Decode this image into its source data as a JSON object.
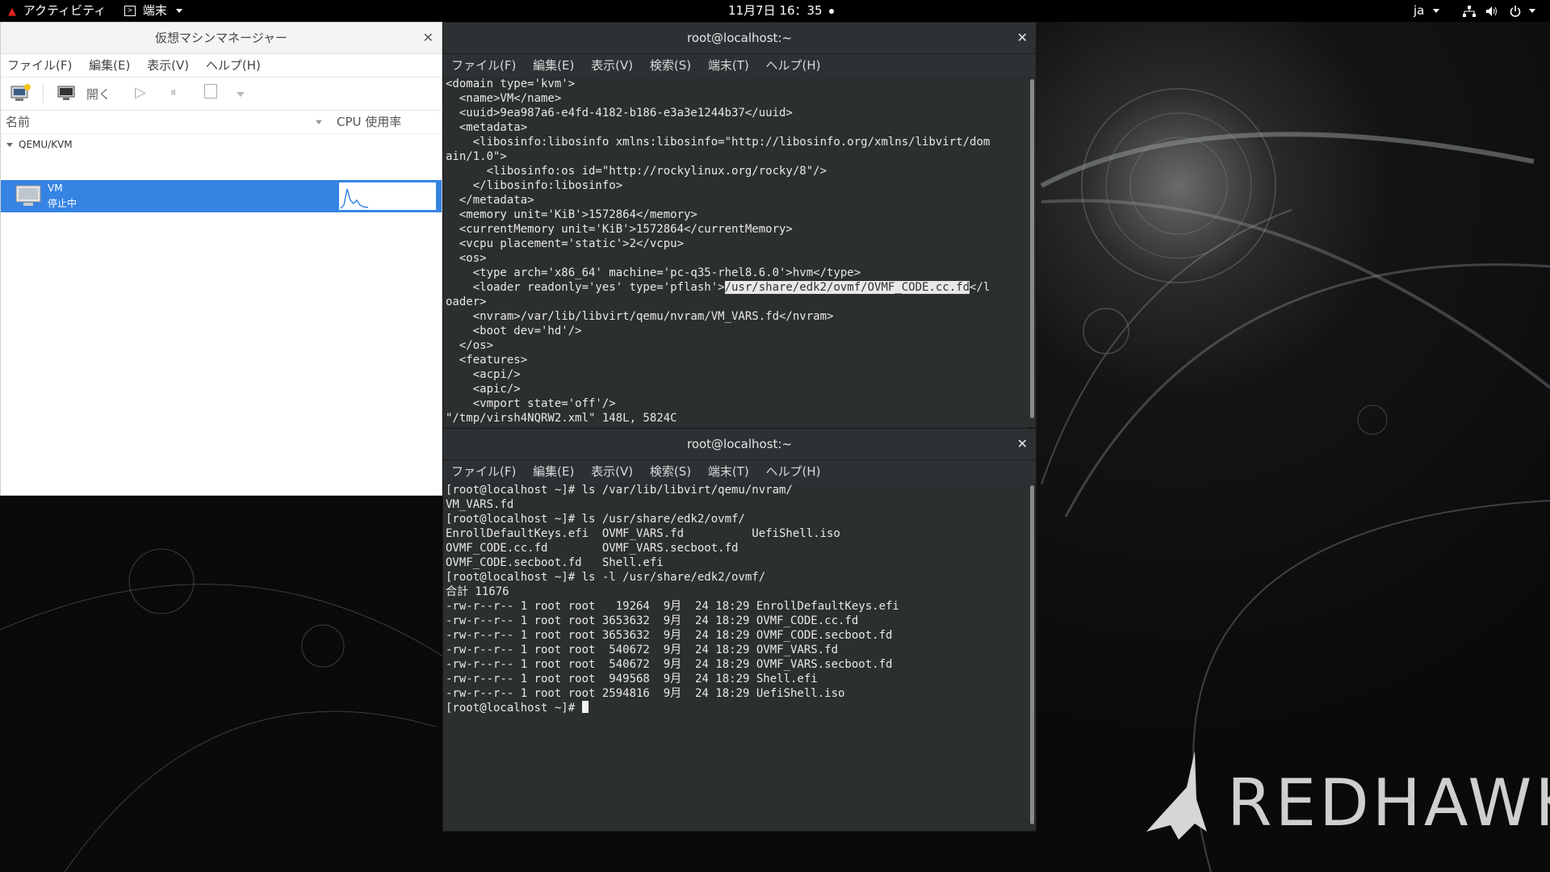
{
  "topbar": {
    "activities": "アクティビティ",
    "app_menu": "端末",
    "clock": "11月7日 16：35",
    "lang": "ja"
  },
  "vmm": {
    "title": "仮想マシンマネージャー",
    "menu": [
      "ファイル(F)",
      "編集(E)",
      "表示(V)",
      "ヘルプ(H)"
    ],
    "toolbar_open": "開く",
    "col_name": "名前",
    "col_cpu": "CPU 使用率",
    "group": "QEMU/KVM",
    "vm_name": "VM",
    "vm_status": "停止中"
  },
  "term_menu": [
    "ファイル(F)",
    "編集(E)",
    "表示(V)",
    "検索(S)",
    "端末(T)",
    "ヘルプ(H)"
  ],
  "term1": {
    "title": "root@localhost:~",
    "lines": [
      "<domain type='kvm'>",
      "  <name>VM</name>",
      "  <uuid>9ea987a6-e4fd-4182-b186-e3a3e1244b37</uuid>",
      "  <metadata>",
      "    <libosinfo:libosinfo xmlns:libosinfo=\"http://libosinfo.org/xmlns/libvirt/dom",
      "ain/1.0\">",
      "      <libosinfo:os id=\"http://rockylinux.org/rocky/8\"/>",
      "    </libosinfo:libosinfo>",
      "  </metadata>",
      "  <memory unit='KiB'>1572864</memory>",
      "  <currentMemory unit='KiB'>1572864</currentMemory>",
      "  <vcpu placement='static'>2</vcpu>",
      "  <os>",
      "    <type arch='x86_64' machine='pc-q35-rhel8.6.0'>hvm</type>"
    ],
    "loader_prefix": "    <loader readonly='yes' type='pflash'>",
    "loader_highlight": "/usr/share/edk2/ovmf/OVMF_CODE.cc.fd",
    "loader_suffix": "</l",
    "lines2": [
      "oader>",
      "    <nvram>/var/lib/libvirt/qemu/nvram/VM_VARS.fd</nvram>",
      "    <boot dev='hd'/>",
      "  </os>",
      "  <features>",
      "    <acpi/>",
      "    <apic/>",
      "    <vmport state='off'/>",
      "\"/tmp/virsh4NQRW2.xml\" 148L, 5824C"
    ]
  },
  "term2": {
    "title": "root@localhost:~",
    "lines": [
      "[root@localhost ~]# ls /var/lib/libvirt/qemu/nvram/",
      "VM_VARS.fd",
      "[root@localhost ~]# ls /usr/share/edk2/ovmf/",
      "EnrollDefaultKeys.efi  OVMF_VARS.fd          UefiShell.iso",
      "OVMF_CODE.cc.fd        OVMF_VARS.secboot.fd",
      "OVMF_CODE.secboot.fd   Shell.efi",
      "[root@localhost ~]# ls -l /usr/share/edk2/ovmf/",
      "合計 11676",
      "-rw-r--r-- 1 root root   19264  9月  24 18:29 EnrollDefaultKeys.efi",
      "-rw-r--r-- 1 root root 3653632  9月  24 18:29 OVMF_CODE.cc.fd",
      "-rw-r--r-- 1 root root 3653632  9月  24 18:29 OVMF_CODE.secboot.fd",
      "-rw-r--r-- 1 root root  540672  9月  24 18:29 OVMF_VARS.fd",
      "-rw-r--r-- 1 root root  540672  9月  24 18:29 OVMF_VARS.secboot.fd",
      "-rw-r--r-- 1 root root  949568  9月  24 18:29 Shell.efi",
      "-rw-r--r-- 1 root root 2594816  9月  24 18:29 UefiShell.iso"
    ],
    "prompt": "[root@localhost ~]# "
  },
  "brand": "REDHAWK",
  "icons": [
    "redhawk-logo-icon",
    "terminal-icon",
    "network-icon",
    "volume-icon",
    "power-icon",
    "close-icon",
    "new-vm-icon",
    "monitor-icon",
    "play-icon",
    "pause-icon",
    "stop-icon",
    "computer-icon"
  ]
}
